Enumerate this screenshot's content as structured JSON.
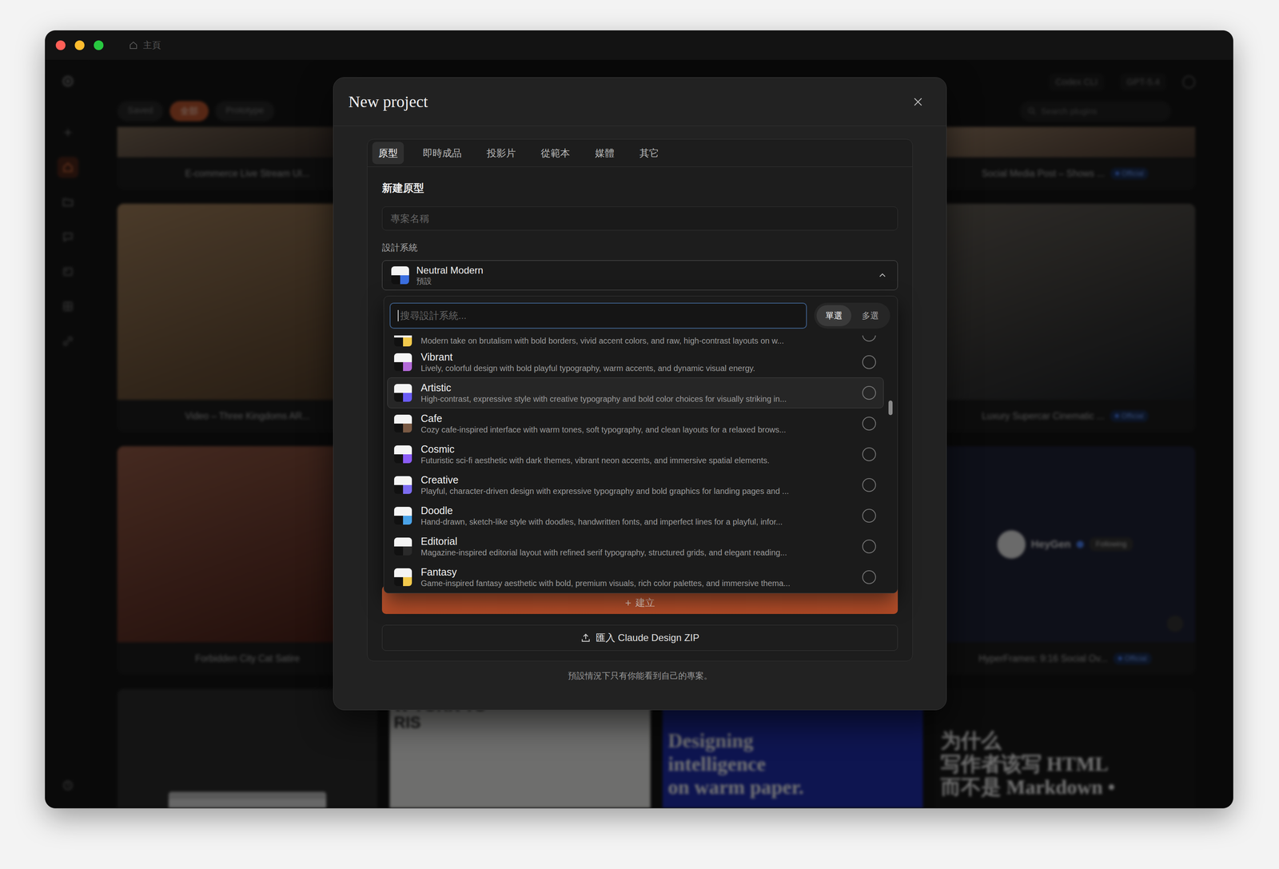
{
  "window": {
    "title": "主頁"
  },
  "sidebar": {
    "items": [
      {
        "selected": false
      },
      {
        "selected": false
      },
      {
        "selected": true
      },
      {
        "selected": false
      },
      {
        "selected": false
      },
      {
        "selected": false
      },
      {
        "selected": false
      },
      {
        "selected": false
      },
      {
        "selected": false
      }
    ]
  },
  "toolbar": {
    "models": [
      "Codex CLI",
      "GPT-5.4"
    ]
  },
  "filters": [
    {
      "label": "Saved",
      "selected": false
    },
    {
      "label": "全部",
      "selected": true
    },
    {
      "label": "Prototype",
      "selected": false
    }
  ],
  "gallery_search": {
    "placeholder": "Search plugins"
  },
  "gallery": {
    "rows": [
      {
        "cards": [
          {
            "kind": "photo",
            "title": "E-commerce Live Stream UI...",
            "badge": "",
            "color": "#4a3d36"
          },
          {
            "kind": "covered"
          },
          {
            "kind": "covered"
          },
          {
            "kind": "photo",
            "title": "Social Media Post – Shows ...",
            "badge": "Official",
            "color": "#6a5446"
          }
        ]
      },
      {
        "cards": [
          {
            "kind": "photo",
            "title": "Video – Three Kingdoms AR...",
            "badge": "",
            "color": "#7a5a3c"
          },
          {
            "kind": "covered"
          },
          {
            "kind": "covered"
          },
          {
            "kind": "photo",
            "title": "Luxury Supercar Cinematic ...",
            "badge": "Official",
            "color": "#2c3036"
          }
        ]
      },
      {
        "cards": [
          {
            "kind": "photo",
            "title": "Forbidden City Cat Satire",
            "badge": "",
            "color": "#6b2c22"
          },
          {
            "kind": "covered"
          },
          {
            "kind": "covered"
          },
          {
            "kind": "social",
            "title": "HyperFrames: 9:16 Social Ov...",
            "badge": "Official",
            "account": "HeyGen",
            "follow": "Following",
            "color": "#1f2235"
          }
        ]
      },
      {
        "cards": [
          {
            "kind": "shot",
            "color": "#2a2a2a"
          },
          {
            "kind": "map",
            "lines": [
              "W YORK TO",
              "RIS"
            ],
            "color": "#e6e6e3"
          },
          {
            "kind": "poster",
            "lines": [
              "Designing",
              "intelligence",
              "on warm paper."
            ],
            "color": "#1e2ca8"
          },
          {
            "kind": "poster",
            "lines": [
              "为什么",
              "写作者该写 HTML",
              "而不是 Markdown •"
            ],
            "color": "#181818"
          }
        ]
      }
    ]
  },
  "modal": {
    "title": "New project",
    "tabs": [
      {
        "label": "原型",
        "selected": true
      },
      {
        "label": "即時成品",
        "selected": false
      },
      {
        "label": "投影片",
        "selected": false
      },
      {
        "label": "從範本",
        "selected": false
      },
      {
        "label": "媒體",
        "selected": false
      },
      {
        "label": "其它",
        "selected": false
      }
    ],
    "heading": "新建原型",
    "name_placeholder": "專案名稱",
    "design_label": "設計系統",
    "selected_system": {
      "name": "Neutral Modern",
      "note": "預設",
      "color": "#3b6fe0"
    },
    "dropdown": {
      "open": true,
      "search_placeholder": "搜尋設計系統...",
      "modes": [
        {
          "label": "單選",
          "selected": true
        },
        {
          "label": "多選",
          "selected": false
        }
      ],
      "scroll_position": 0.27,
      "systems": [
        {
          "kind": "clipped",
          "name": "",
          "description": "Modern take on brutalism with bold borders, vivid accent colors, and raw, high-contrast layouts on w...",
          "color": "#f2c94c",
          "selected": false,
          "highlighted": false
        },
        {
          "kind": "full",
          "name": "Vibrant",
          "description": "Lively, colorful design with bold playful typography, warm accents, and dynamic visual energy.",
          "color": "#b36ad8",
          "selected": false,
          "highlighted": false
        },
        {
          "kind": "full",
          "name": "Artistic",
          "description": "High-contrast, expressive style with creative typography and bold color choices for visually striking in...",
          "color": "#6a5cf5",
          "selected": false,
          "highlighted": true
        },
        {
          "kind": "full",
          "name": "Cafe",
          "description": "Cozy cafe-inspired interface with warm tones, soft typography, and clean layouts for a relaxed brows...",
          "color": "#7a5a44",
          "selected": false,
          "highlighted": false
        },
        {
          "kind": "full",
          "name": "Cosmic",
          "description": "Futuristic sci-fi aesthetic with dark themes, vibrant neon accents, and immersive spatial elements.",
          "color": "#8b5cf6",
          "selected": false,
          "highlighted": false
        },
        {
          "kind": "full",
          "name": "Creative",
          "description": "Playful, character-driven design with expressive typography and bold graphics for landing pages and ...",
          "color": "#7c6cf0",
          "selected": false,
          "highlighted": false
        },
        {
          "kind": "full",
          "name": "Doodle",
          "description": "Hand-drawn, sketch-like style with doodles, handwritten fonts, and imperfect lines for a playful, infor...",
          "color": "#4aa3e8",
          "selected": false,
          "highlighted": false
        },
        {
          "kind": "full",
          "name": "Editorial",
          "description": "Magazine-inspired editorial layout with refined serif typography, structured grids, and elegant reading...",
          "color": "#2a2a2a",
          "selected": false,
          "highlighted": false
        },
        {
          "kind": "full",
          "name": "Fantasy",
          "description": "Game-inspired fantasy aesthetic with bold, premium visuals, rich color palettes, and immersive thema...",
          "color": "#f2c94c",
          "selected": false,
          "highlighted": false
        }
      ]
    },
    "create": {
      "icon": "+",
      "label": "建立"
    },
    "import": {
      "label": "匯入 Claude Design ZIP"
    },
    "footer": "預設情況下只有你能看到自己的專案。"
  }
}
